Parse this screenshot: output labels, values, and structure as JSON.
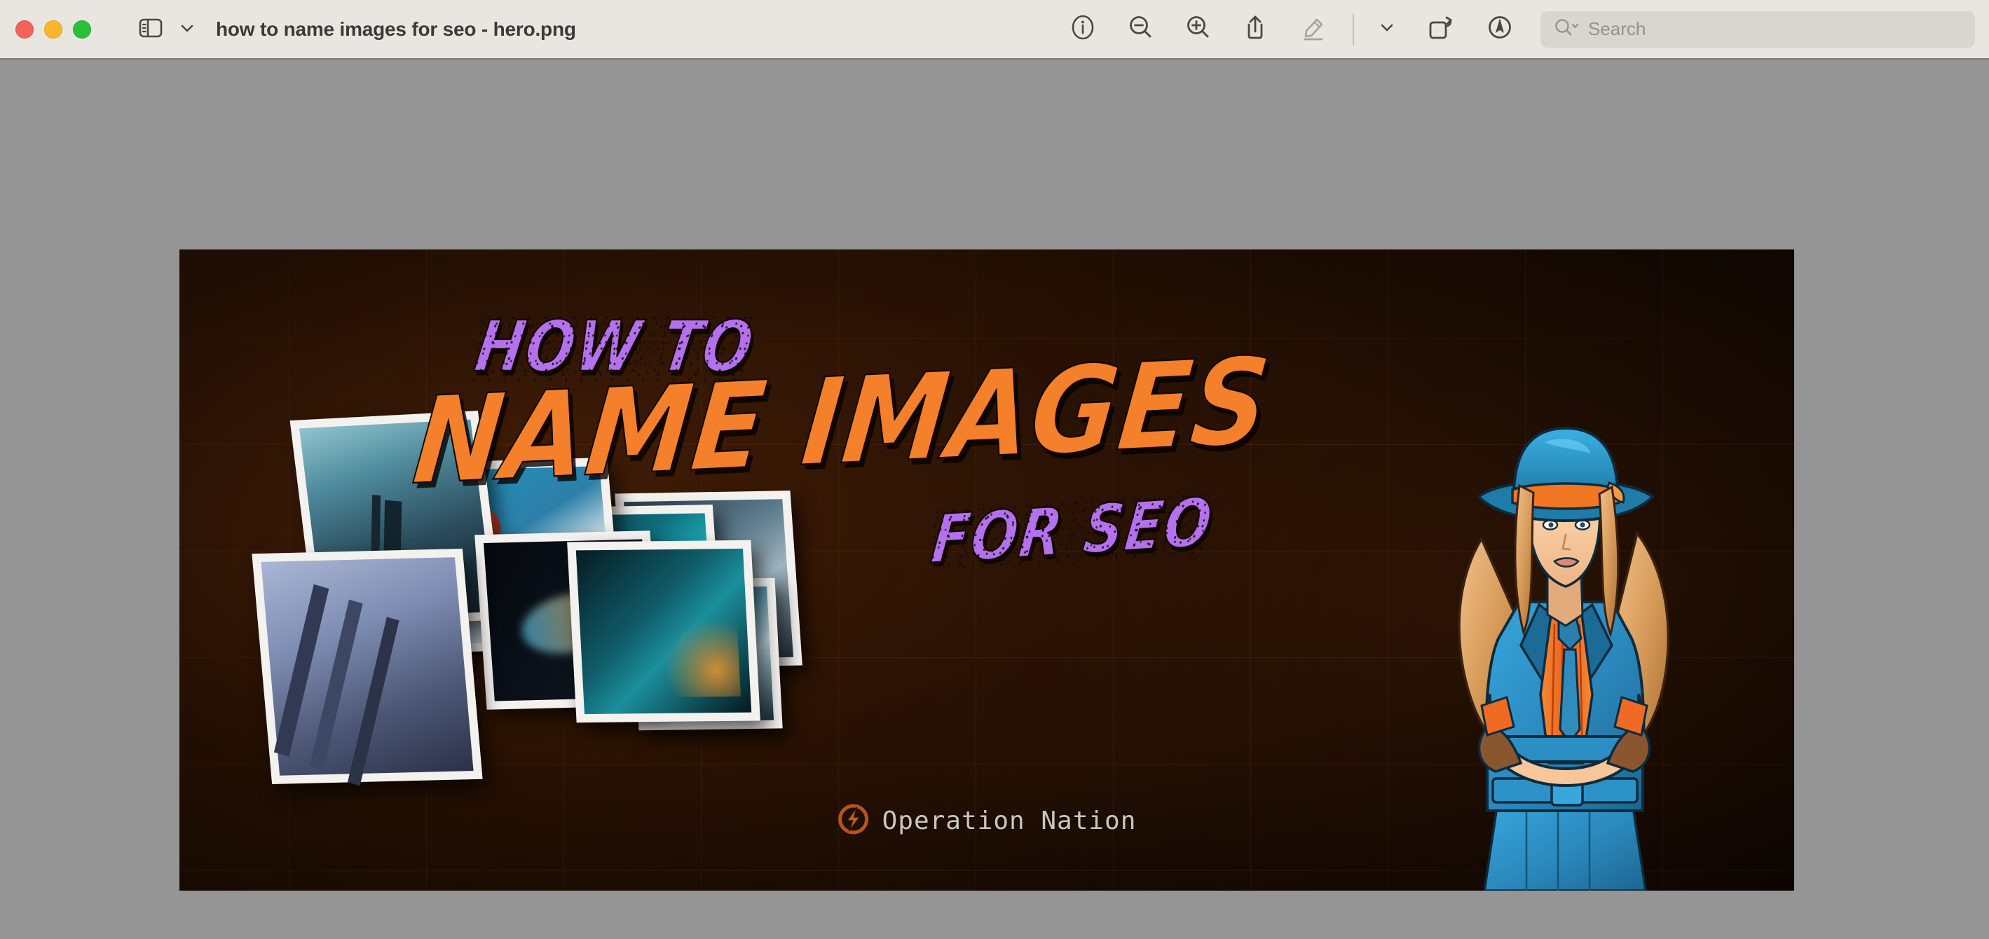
{
  "window": {
    "title": "how to name images for seo - hero.png",
    "traffic_lights": [
      {
        "name": "close",
        "color": "#f4625a"
      },
      {
        "name": "minimize",
        "color": "#fcb52c"
      },
      {
        "name": "zoom",
        "color": "#2ac03a"
      }
    ],
    "sidebar_toggle_icon": "sidebar-icon",
    "sidebar_menu_icon": "chevron-down-icon"
  },
  "toolbar": {
    "items": [
      {
        "name": "info-button",
        "icon": "info-circle-icon",
        "disabled": false
      },
      {
        "name": "zoom-out-button",
        "icon": "zoom-out-icon",
        "disabled": false
      },
      {
        "name": "zoom-in-button",
        "icon": "zoom-in-icon",
        "disabled": false
      },
      {
        "name": "share-button",
        "icon": "share-icon",
        "disabled": false
      },
      {
        "name": "markup-button",
        "icon": "pencil-icon",
        "disabled": true
      },
      {
        "name": "markup-menu-button",
        "icon": "chevron-down-icon",
        "disabled": false
      },
      {
        "name": "rotate-button",
        "icon": "rotate-icon",
        "disabled": false
      },
      {
        "name": "annotate-button",
        "icon": "pen-nib-circle-icon",
        "disabled": false
      }
    ]
  },
  "search": {
    "placeholder": "Search",
    "icon": "search-icon",
    "chevron": "chevron-down-icon",
    "value": ""
  },
  "viewer": {
    "background_color": "#959595",
    "zoom_fit": true
  },
  "poster": {
    "background_color": "#241003",
    "grid_color": "#a85212",
    "headline": {
      "eyebrow": "HOW TO",
      "main": "NAME IMAGES",
      "kicker": "FOR SEO",
      "eyebrow_color": "#b471ee",
      "main_color": "#f4802b",
      "kicker_color": "#b471ee"
    },
    "brand": {
      "name": "Operation Nation",
      "logo_icon": "operation-nation-logo-icon",
      "logo_color": "#b5561d",
      "text_color": "#c9c6c1"
    },
    "collage": {
      "label": "photo-collage",
      "photos": [
        {
          "name": "photo-clouds-tower",
          "style": "ph-clouds"
        },
        {
          "name": "photo-blue-spheres",
          "style": "ph-spheres"
        },
        {
          "name": "photo-red-abstract",
          "style": "ph-balls"
        },
        {
          "name": "photo-dark-smoke",
          "style": "ph-dark"
        },
        {
          "name": "photo-teal-waves",
          "style": "ph-wave"
        },
        {
          "name": "photo-steel-rig",
          "style": "ph-steel"
        },
        {
          "name": "photo-chrome-balls",
          "style": "ph-teal"
        },
        {
          "name": "photo-frost-crystal",
          "style": "ph-frost"
        }
      ]
    },
    "character": {
      "name": "detective-woman-illustration",
      "hat_color": "#2e9fd4",
      "hat_band_color": "#f07622",
      "coat_color": "#2b8fc4",
      "shirt_color": "#ef6a22",
      "tie_color": "#2a7fae",
      "hair_color": "#e3a766",
      "skin_color": "#f6c79c",
      "glove_color": "#8a5630"
    }
  }
}
